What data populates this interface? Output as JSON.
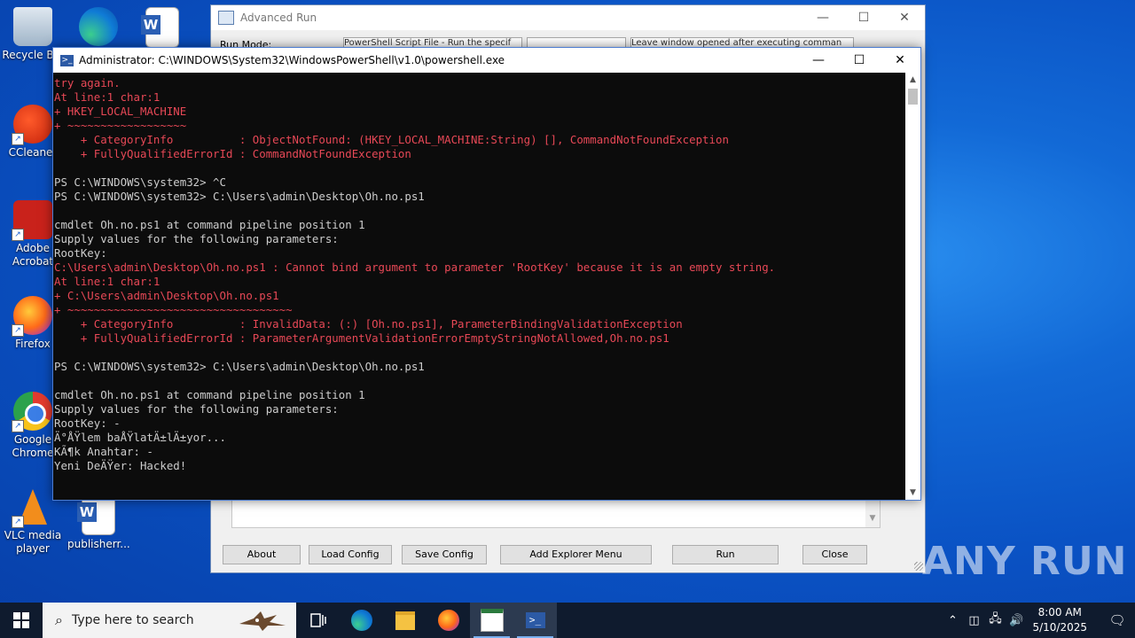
{
  "desktop": {
    "icons": [
      {
        "label": "Recycle Bin",
        "icon": "recycle-bin-icon"
      },
      {
        "label": "CCleaner",
        "icon": "ccleaner-icon"
      },
      {
        "label": "Adobe Acrobat",
        "icon": "adobe-acrobat-icon"
      },
      {
        "label": "Firefox",
        "icon": "firefox-icon"
      },
      {
        "label": "Google Chrome",
        "icon": "chrome-icon"
      },
      {
        "label": "VLC media player",
        "icon": "vlc-icon"
      },
      {
        "label": "publisherr...",
        "icon": "word-document-icon"
      }
    ]
  },
  "advanced_run": {
    "title": "Advanced Run",
    "run_mode_label": "Run Mode:",
    "run_mode_value": "PowerShell Script File - Run the specif",
    "window_state_value": "Leave window opened after executing comman",
    "buttons": {
      "about": "About",
      "load_config": "Load Config",
      "save_config": "Save Config",
      "add_explorer_menu": "Add Explorer Menu",
      "run": "Run",
      "close": "Close"
    }
  },
  "powershell": {
    "title": "Administrator: C:\\WINDOWS\\System32\\WindowsPowerShell\\v1.0\\powershell.exe",
    "lines": [
      {
        "text": "try again.",
        "color": "red"
      },
      {
        "text": "At line:1 char:1",
        "color": "red"
      },
      {
        "text": "+ HKEY_LOCAL_MACHINE",
        "color": "red"
      },
      {
        "text": "+ ~~~~~~~~~~~~~~~~~~",
        "color": "red"
      },
      {
        "text": "    + CategoryInfo          : ObjectNotFound: (HKEY_LOCAL_MACHINE:String) [], CommandNotFoundException",
        "color": "red"
      },
      {
        "text": "    + FullyQualifiedErrorId : CommandNotFoundException",
        "color": "red"
      },
      {
        "text": "",
        "color": "white"
      },
      {
        "text": "PS C:\\WINDOWS\\system32> ^C",
        "color": "white"
      },
      {
        "text": "PS C:\\WINDOWS\\system32> C:\\Users\\admin\\Desktop\\Oh.no.ps1",
        "color": "white"
      },
      {
        "text": "",
        "color": "white"
      },
      {
        "text": "cmdlet Oh.no.ps1 at command pipeline position 1",
        "color": "white"
      },
      {
        "text": "Supply values for the following parameters:",
        "color": "white"
      },
      {
        "text": "RootKey:",
        "color": "white"
      },
      {
        "text": "C:\\Users\\admin\\Desktop\\Oh.no.ps1 : Cannot bind argument to parameter 'RootKey' because it is an empty string.",
        "color": "red"
      },
      {
        "text": "At line:1 char:1",
        "color": "red"
      },
      {
        "text": "+ C:\\Users\\admin\\Desktop\\Oh.no.ps1",
        "color": "red"
      },
      {
        "text": "+ ~~~~~~~~~~~~~~~~~~~~~~~~~~~~~~~~~~",
        "color": "red"
      },
      {
        "text": "    + CategoryInfo          : InvalidData: (:) [Oh.no.ps1], ParameterBindingValidationException",
        "color": "red"
      },
      {
        "text": "    + FullyQualifiedErrorId : ParameterArgumentValidationErrorEmptyStringNotAllowed,Oh.no.ps1",
        "color": "red"
      },
      {
        "text": "",
        "color": "white"
      },
      {
        "text": "PS C:\\WINDOWS\\system32> C:\\Users\\admin\\Desktop\\Oh.no.ps1",
        "color": "white"
      },
      {
        "text": "",
        "color": "white"
      },
      {
        "text": "cmdlet Oh.no.ps1 at command pipeline position 1",
        "color": "white"
      },
      {
        "text": "Supply values for the following parameters:",
        "color": "white"
      },
      {
        "text": "RootKey: -",
        "color": "white"
      },
      {
        "text": "Ä°ÅŸlem baÅŸlatÄ±lÄ±yor...",
        "color": "white"
      },
      {
        "text": "KÃ¶k Anahtar: -",
        "color": "white"
      },
      {
        "text": "Yeni DeÄŸer: Hacked!",
        "color": "white"
      }
    ]
  },
  "watermark": "ANY RUN",
  "taskbar": {
    "search_placeholder": "Type here to search",
    "apps": [
      "task-view-icon",
      "edge-icon",
      "file-explorer-icon",
      "firefox-icon",
      "advanced-run-icon",
      "powershell-icon"
    ],
    "time": "8:00 AM",
    "date": "5/10/2025"
  }
}
